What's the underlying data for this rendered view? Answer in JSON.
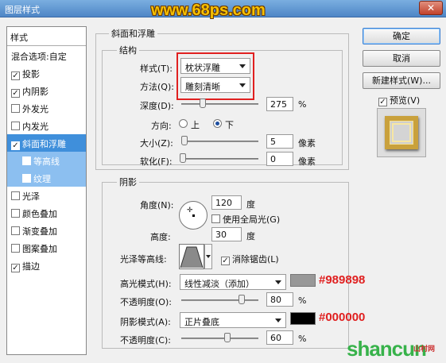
{
  "window": {
    "title": "图层样式",
    "watermark_top": "www.68ps.com",
    "close": "✕"
  },
  "style_list": {
    "header": "样式",
    "items": [
      {
        "label": "混合选项:自定",
        "checkbox": false,
        "checked": false,
        "state": "normal"
      },
      {
        "label": "投影",
        "checkbox": true,
        "checked": true,
        "state": "normal"
      },
      {
        "label": "内阴影",
        "checkbox": true,
        "checked": true,
        "state": "normal"
      },
      {
        "label": "外发光",
        "checkbox": true,
        "checked": false,
        "state": "normal"
      },
      {
        "label": "内发光",
        "checkbox": true,
        "checked": false,
        "state": "normal"
      },
      {
        "label": "斜面和浮雕",
        "checkbox": true,
        "checked": true,
        "state": "selected"
      },
      {
        "label": "等高线",
        "checkbox": true,
        "checked": false,
        "state": "sub"
      },
      {
        "label": "纹理",
        "checkbox": true,
        "checked": false,
        "state": "sub"
      },
      {
        "label": "光泽",
        "checkbox": true,
        "checked": false,
        "state": "normal"
      },
      {
        "label": "颜色叠加",
        "checkbox": true,
        "checked": false,
        "state": "normal"
      },
      {
        "label": "渐变叠加",
        "checkbox": true,
        "checked": false,
        "state": "normal"
      },
      {
        "label": "图案叠加",
        "checkbox": true,
        "checked": false,
        "state": "normal"
      },
      {
        "label": "描边",
        "checkbox": true,
        "checked": true,
        "state": "normal"
      }
    ]
  },
  "bevel": {
    "group_title": "斜面和浮雕",
    "structure_title": "结构",
    "style_label": "样式(T):",
    "style_value": "枕状浮雕",
    "technique_label": "方法(Q):",
    "technique_value": "雕刻清晰",
    "depth_label": "深度(D):",
    "depth_value": "275",
    "depth_unit": "%",
    "depth_level": 0.27,
    "direction_label": "方向:",
    "direction_up": "上",
    "direction_down": "下",
    "direction_selected": "down",
    "size_label": "大小(Z):",
    "size_value": "5",
    "size_unit": "像素",
    "size_level": 0.02,
    "soften_label": "软化(F):",
    "soften_value": "0",
    "soften_unit": "像素",
    "soften_level": 0.0
  },
  "shading": {
    "title": "阴影",
    "angle_label": "角度(N):",
    "angle_value": "120",
    "angle_unit": "度",
    "global_light_label": "使用全局光(G)",
    "global_light_checked": false,
    "altitude_label": "高度:",
    "altitude_value": "30",
    "altitude_unit": "度",
    "gloss_contour_label": "光泽等高线:",
    "anti_alias_label": "消除锯齿(L)",
    "anti_alias_checked": true,
    "highlight_mode_label": "高光模式(H):",
    "highlight_mode_value": "线性减淡（添加）",
    "highlight_color": "#989898",
    "highlight_annotation": "#989898",
    "highlight_opacity_label": "不透明度(O):",
    "highlight_opacity_value": "80",
    "highlight_opacity_level": 0.8,
    "shadow_mode_label": "阴影模式(A):",
    "shadow_mode_value": "正片叠底",
    "shadow_color": "#000000",
    "shadow_annotation": "#000000",
    "shadow_opacity_label": "不透明度(C):",
    "shadow_opacity_value": "60",
    "shadow_opacity_level": 0.6,
    "percent": "%"
  },
  "buttons": {
    "ok": "确定",
    "cancel": "取消",
    "new_style": "新建样式(W)...",
    "preview_label": "预览(V)",
    "preview_checked": true
  },
  "watermark_bottom": {
    "main": "shancun",
    "sub": "山村网"
  }
}
